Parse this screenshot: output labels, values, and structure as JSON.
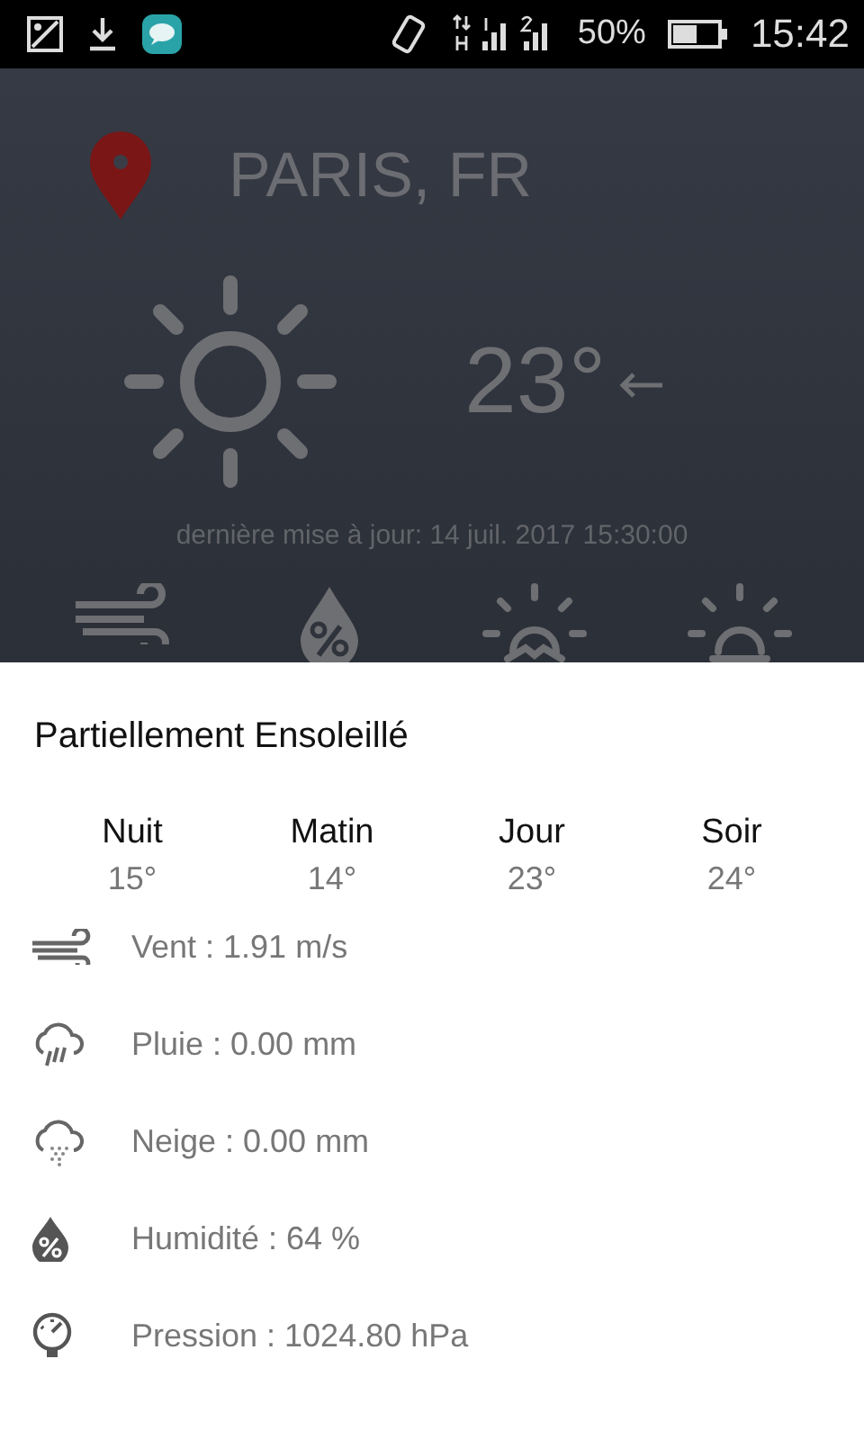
{
  "status_bar": {
    "battery": "50%",
    "time": "15:42"
  },
  "location": "PARIS, FR",
  "temperature": "23°",
  "last_update": "dernière mise à jour: 14 juil. 2017 15:30:00",
  "summary_icons": [
    {
      "kind": "wind"
    },
    {
      "kind": "humidity"
    },
    {
      "kind": "sunrise"
    },
    {
      "kind": "sunset"
    }
  ],
  "sheet": {
    "condition": "Partiellement Ensoleillé",
    "periods": [
      {
        "label": "Nuit",
        "temp": "15°"
      },
      {
        "label": "Matin",
        "temp": "14°"
      },
      {
        "label": "Jour",
        "temp": "23°"
      },
      {
        "label": "Soir",
        "temp": "24°"
      }
    ],
    "details": [
      {
        "kind": "wind",
        "text": "Vent : 1.91 m/s"
      },
      {
        "kind": "rain",
        "text": "Pluie : 0.00 mm"
      },
      {
        "kind": "snow",
        "text": "Neige : 0.00 mm"
      },
      {
        "kind": "humidity",
        "text": "Humidité : 64 %"
      },
      {
        "kind": "pressure",
        "text": "Pression : 1024.80 hPa"
      }
    ]
  }
}
